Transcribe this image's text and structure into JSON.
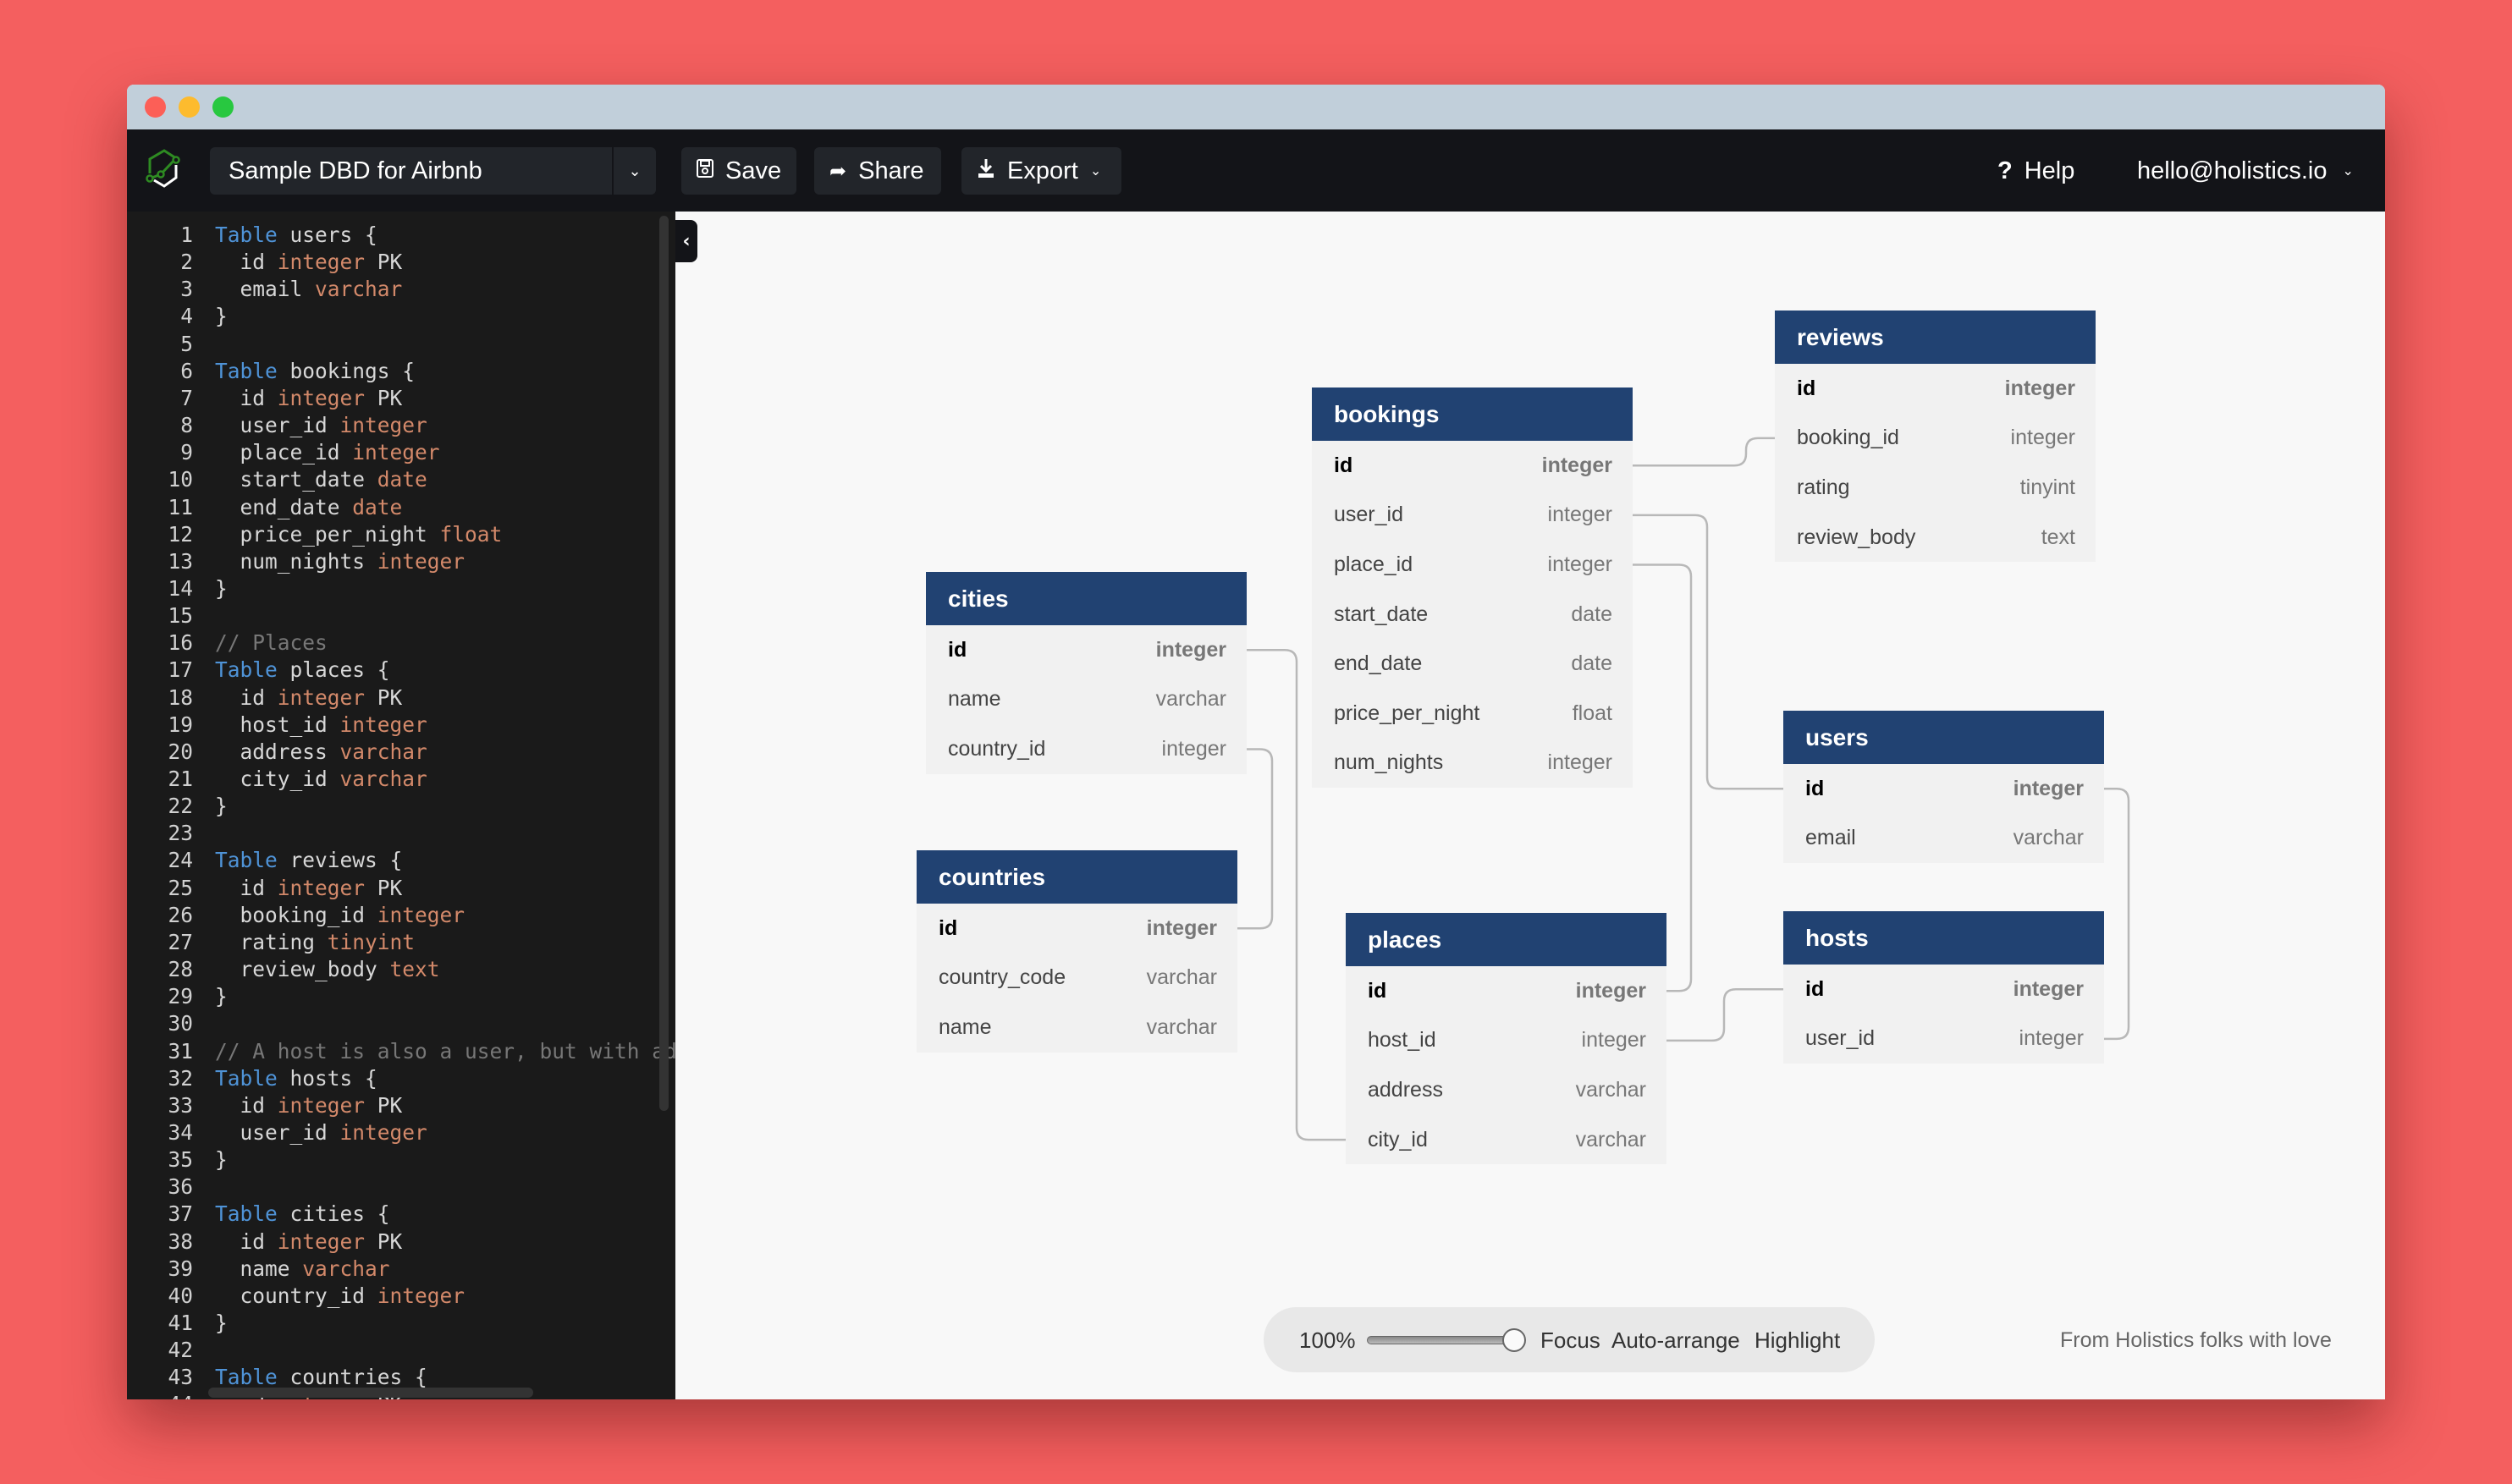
{
  "header": {
    "doc_title": "Sample DBD for Airbnb",
    "save_label": "Save",
    "share_label": "Share",
    "export_label": "Export",
    "help_label": "Help",
    "account_email": "hello@holistics.io"
  },
  "editor": {
    "lines": [
      [
        {
          "t": "Table",
          "c": "kw"
        },
        {
          "t": " users {"
        }
      ],
      [
        {
          "t": "  id "
        },
        {
          "t": "integer",
          "c": "ty"
        },
        {
          "t": " PK"
        }
      ],
      [
        {
          "t": "  email "
        },
        {
          "t": "varchar",
          "c": "ty"
        }
      ],
      [
        {
          "t": "}"
        }
      ],
      [],
      [
        {
          "t": "Table",
          "c": "kw"
        },
        {
          "t": " bookings {"
        }
      ],
      [
        {
          "t": "  id "
        },
        {
          "t": "integer",
          "c": "ty"
        },
        {
          "t": " PK"
        }
      ],
      [
        {
          "t": "  user_id "
        },
        {
          "t": "integer",
          "c": "ty"
        }
      ],
      [
        {
          "t": "  place_id "
        },
        {
          "t": "integer",
          "c": "ty"
        }
      ],
      [
        {
          "t": "  start_date "
        },
        {
          "t": "date",
          "c": "ty"
        }
      ],
      [
        {
          "t": "  end_date "
        },
        {
          "t": "date",
          "c": "ty"
        }
      ],
      [
        {
          "t": "  price_per_night "
        },
        {
          "t": "float",
          "c": "ty"
        }
      ],
      [
        {
          "t": "  num_nights "
        },
        {
          "t": "integer",
          "c": "ty"
        }
      ],
      [
        {
          "t": "}"
        }
      ],
      [],
      [
        {
          "t": "// Places",
          "c": "cm"
        }
      ],
      [
        {
          "t": "Table",
          "c": "kw"
        },
        {
          "t": " places {"
        }
      ],
      [
        {
          "t": "  id "
        },
        {
          "t": "integer",
          "c": "ty"
        },
        {
          "t": " PK"
        }
      ],
      [
        {
          "t": "  host_id "
        },
        {
          "t": "integer",
          "c": "ty"
        }
      ],
      [
        {
          "t": "  address "
        },
        {
          "t": "varchar",
          "c": "ty"
        }
      ],
      [
        {
          "t": "  city_id "
        },
        {
          "t": "varchar",
          "c": "ty"
        }
      ],
      [
        {
          "t": "}"
        }
      ],
      [],
      [
        {
          "t": "Table",
          "c": "kw"
        },
        {
          "t": " reviews {"
        }
      ],
      [
        {
          "t": "  id "
        },
        {
          "t": "integer",
          "c": "ty"
        },
        {
          "t": " PK"
        }
      ],
      [
        {
          "t": "  booking_id "
        },
        {
          "t": "integer",
          "c": "ty"
        }
      ],
      [
        {
          "t": "  rating "
        },
        {
          "t": "tinyint",
          "c": "ty"
        }
      ],
      [
        {
          "t": "  review_body "
        },
        {
          "t": "text",
          "c": "ty"
        }
      ],
      [
        {
          "t": "}"
        }
      ],
      [],
      [
        {
          "t": "// A host is also a user, but with ad",
          "c": "cm"
        }
      ],
      [
        {
          "t": "Table",
          "c": "kw"
        },
        {
          "t": " hosts {"
        }
      ],
      [
        {
          "t": "  id "
        },
        {
          "t": "integer",
          "c": "ty"
        },
        {
          "t": " PK"
        }
      ],
      [
        {
          "t": "  user_id "
        },
        {
          "t": "integer",
          "c": "ty"
        }
      ],
      [
        {
          "t": "}"
        }
      ],
      [],
      [
        {
          "t": "Table",
          "c": "kw"
        },
        {
          "t": " cities {"
        }
      ],
      [
        {
          "t": "  id "
        },
        {
          "t": "integer",
          "c": "ty"
        },
        {
          "t": " PK"
        }
      ],
      [
        {
          "t": "  name "
        },
        {
          "t": "varchar",
          "c": "ty"
        }
      ],
      [
        {
          "t": "  country_id "
        },
        {
          "t": "integer",
          "c": "ty"
        }
      ],
      [
        {
          "t": "}"
        }
      ],
      [],
      [
        {
          "t": "Table",
          "c": "kw"
        },
        {
          "t": " countries {"
        }
      ],
      [
        {
          "t": "  id "
        },
        {
          "t": "integer",
          "c": "ty"
        },
        {
          "t": " PK"
        }
      ]
    ]
  },
  "tables": [
    {
      "name": "cities",
      "fields": [
        {
          "name": "id",
          "type": "integer",
          "pk": true
        },
        {
          "name": "name",
          "type": "varchar"
        },
        {
          "name": "country_id",
          "type": "integer"
        }
      ]
    },
    {
      "name": "countries",
      "fields": [
        {
          "name": "id",
          "type": "integer",
          "pk": true
        },
        {
          "name": "country_code",
          "type": "varchar"
        },
        {
          "name": "name",
          "type": "varchar"
        }
      ]
    },
    {
      "name": "bookings",
      "fields": [
        {
          "name": "id",
          "type": "integer",
          "pk": true
        },
        {
          "name": "user_id",
          "type": "integer"
        },
        {
          "name": "place_id",
          "type": "integer"
        },
        {
          "name": "start_date",
          "type": "date"
        },
        {
          "name": "end_date",
          "type": "date"
        },
        {
          "name": "price_per_night",
          "type": "float"
        },
        {
          "name": "num_nights",
          "type": "integer"
        }
      ]
    },
    {
      "name": "reviews",
      "fields": [
        {
          "name": "id",
          "type": "integer",
          "pk": true
        },
        {
          "name": "booking_id",
          "type": "integer"
        },
        {
          "name": "rating",
          "type": "tinyint"
        },
        {
          "name": "review_body",
          "type": "text"
        }
      ]
    },
    {
      "name": "users",
      "fields": [
        {
          "name": "id",
          "type": "integer",
          "pk": true
        },
        {
          "name": "email",
          "type": "varchar"
        }
      ]
    },
    {
      "name": "hosts",
      "fields": [
        {
          "name": "id",
          "type": "integer",
          "pk": true
        },
        {
          "name": "user_id",
          "type": "integer"
        }
      ]
    },
    {
      "name": "places",
      "fields": [
        {
          "name": "id",
          "type": "integer",
          "pk": true
        },
        {
          "name": "host_id",
          "type": "integer"
        },
        {
          "name": "address",
          "type": "varchar"
        },
        {
          "name": "city_id",
          "type": "varchar"
        }
      ]
    }
  ],
  "relationships": [
    {
      "from": "bookings.id",
      "to": "reviews.booking_id"
    },
    {
      "from": "bookings.user_id",
      "to": "users.id"
    },
    {
      "from": "bookings.place_id",
      "to": "places.id"
    },
    {
      "from": "cities.id",
      "to": "places.city_id"
    },
    {
      "from": "cities.country_id",
      "to": "countries.id"
    },
    {
      "from": "places.host_id",
      "to": "hosts.id"
    },
    {
      "from": "users.id",
      "to": "hosts.user_id"
    }
  ],
  "toolbar": {
    "zoom_label": "100%",
    "zoom_level": 1.0,
    "focus_label": "Focus",
    "auto_arrange_label": "Auto-arrange",
    "highlight_label": "Highlight"
  },
  "footer_note": "From Holistics folks with love",
  "colors": {
    "table_header": "#214272",
    "background": "#f45f5f",
    "keyword": "#4f93d7",
    "type": "#d3896a"
  }
}
